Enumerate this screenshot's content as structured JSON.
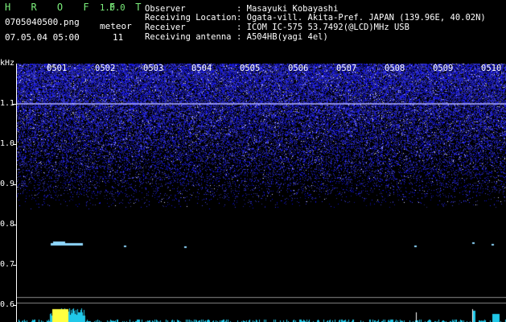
{
  "app": {
    "title": "H R O F F T",
    "version": "1.0.0",
    "filename": "0705040500.png",
    "datetime": "07.05.04 05:00",
    "meteor_label": "meteor",
    "meteor_count": "11"
  },
  "header": {
    "rows": [
      {
        "label": "Observer",
        "value": ": Masayuki Kobayashi"
      },
      {
        "label": "Receiving Location",
        "value": ": Ogata-vill. Akita-Pref. JAPAN (139.96E, 40.02N)"
      },
      {
        "label": "Receiver",
        "value": ": ICOM IC-575 53.7492(@LCD)MHz USB"
      },
      {
        "label": "Receiving antenna",
        "value": ": A504HB(yagi 4el)"
      }
    ]
  },
  "spectrogram": {
    "y_unit": "kHz",
    "y_ticks": [
      "1.1",
      "1.0",
      "0.9",
      "0.8",
      "0.7",
      "0.6"
    ],
    "x_ticks": [
      "0501",
      "0502",
      "0503",
      "0504",
      "0505",
      "0506",
      "0507",
      "0508",
      "0509",
      "0510"
    ],
    "noise_color": "#3030ff",
    "background": "#000000",
    "echo_color": "#8fd8ff",
    "spectrum_color": "#20c8e8",
    "peak_color": "#ffff40"
  }
}
